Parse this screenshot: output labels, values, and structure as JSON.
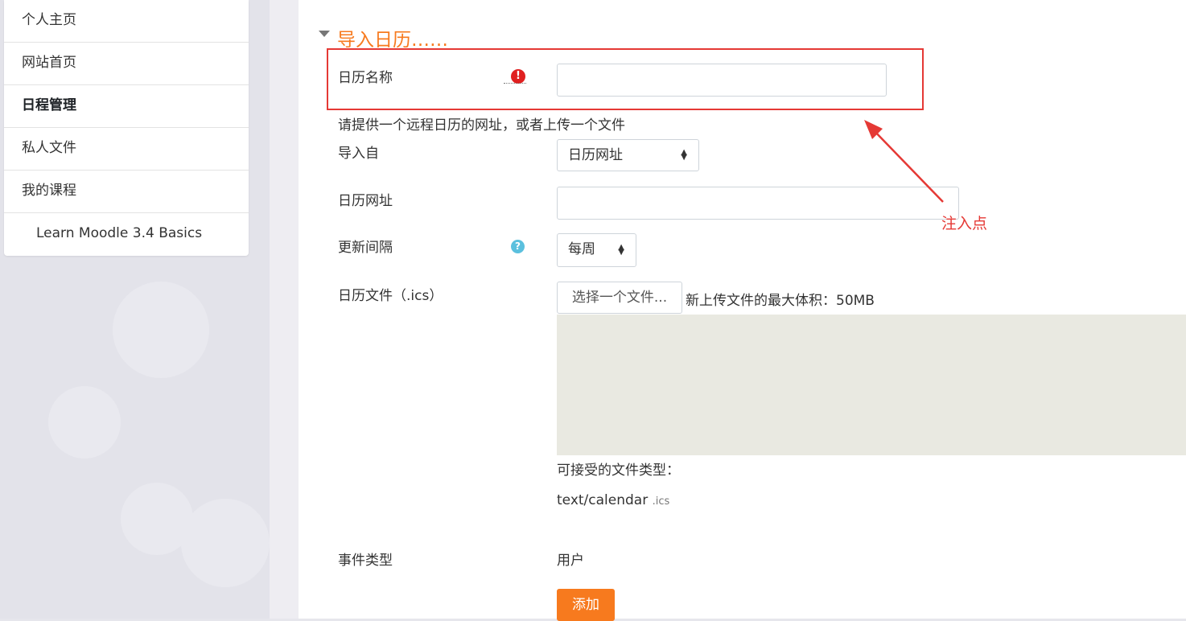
{
  "nav": {
    "items": [
      {
        "label": "个人主页"
      },
      {
        "label": "网站首页"
      },
      {
        "label": "日程管理"
      },
      {
        "label": "私人文件"
      },
      {
        "label": "我的课程"
      },
      {
        "label": "Learn Moodle 3.4 Basics"
      }
    ]
  },
  "form": {
    "section_title": "导入日历……",
    "calendar_name_label": "日历名称",
    "calendar_name_value": "",
    "hint": "请提供一个远程日历的网址，或者上传一个文件",
    "import_from_label": "导入自",
    "import_from_value": "日历网址",
    "calendar_url_label": "日历网址",
    "calendar_url_value": "",
    "update_interval_label": "更新间隔",
    "update_interval_value": "每周",
    "calendar_file_label": "日历文件（.ics）",
    "choose_file_button": "选择一个文件...",
    "max_size": "新上传文件的最大体积：50MB",
    "accepted_types_label": "可接受的文件类型：",
    "accepted_type_mime": "text/calendar",
    "accepted_type_ext": ".ics",
    "event_type_label": "事件类型",
    "event_type_value": "用户",
    "add_button": "添加"
  },
  "annotation": {
    "label": "注入点",
    "color": "#e53935"
  },
  "colors": {
    "accent": "#f77a1e",
    "required": "#e02020",
    "help": "#5bc0de"
  },
  "icons": {
    "required": "exclamation-circle",
    "help": "question-circle",
    "section_toggle": "caret-down"
  }
}
